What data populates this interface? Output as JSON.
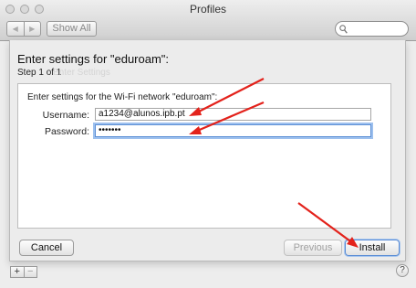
{
  "window": {
    "title": "Profiles"
  },
  "toolbar": {
    "back_icon": "left-arrow",
    "forward_icon": "right-arrow",
    "show_all_label": "Show All",
    "search_icon": "magnifier",
    "search_placeholder": ""
  },
  "sheet": {
    "title": "Enter settings for \"eduroam\":",
    "step": "Step 1 of 1",
    "step_ghost": "Enter Settings",
    "instructions": "Enter settings for the Wi-Fi network \"eduroam\":",
    "fields": [
      {
        "label": "Username:",
        "value": "a1234@alunos.ipb.pt"
      },
      {
        "label": "Password:",
        "value": "•••••••"
      }
    ],
    "buttons": {
      "cancel": "Cancel",
      "previous": "Previous",
      "install": "Install"
    }
  },
  "bottom": {
    "add_label": "+",
    "remove_label": "−",
    "help_label": "?"
  },
  "annotation": {
    "arrow_color": "#e3221b"
  }
}
